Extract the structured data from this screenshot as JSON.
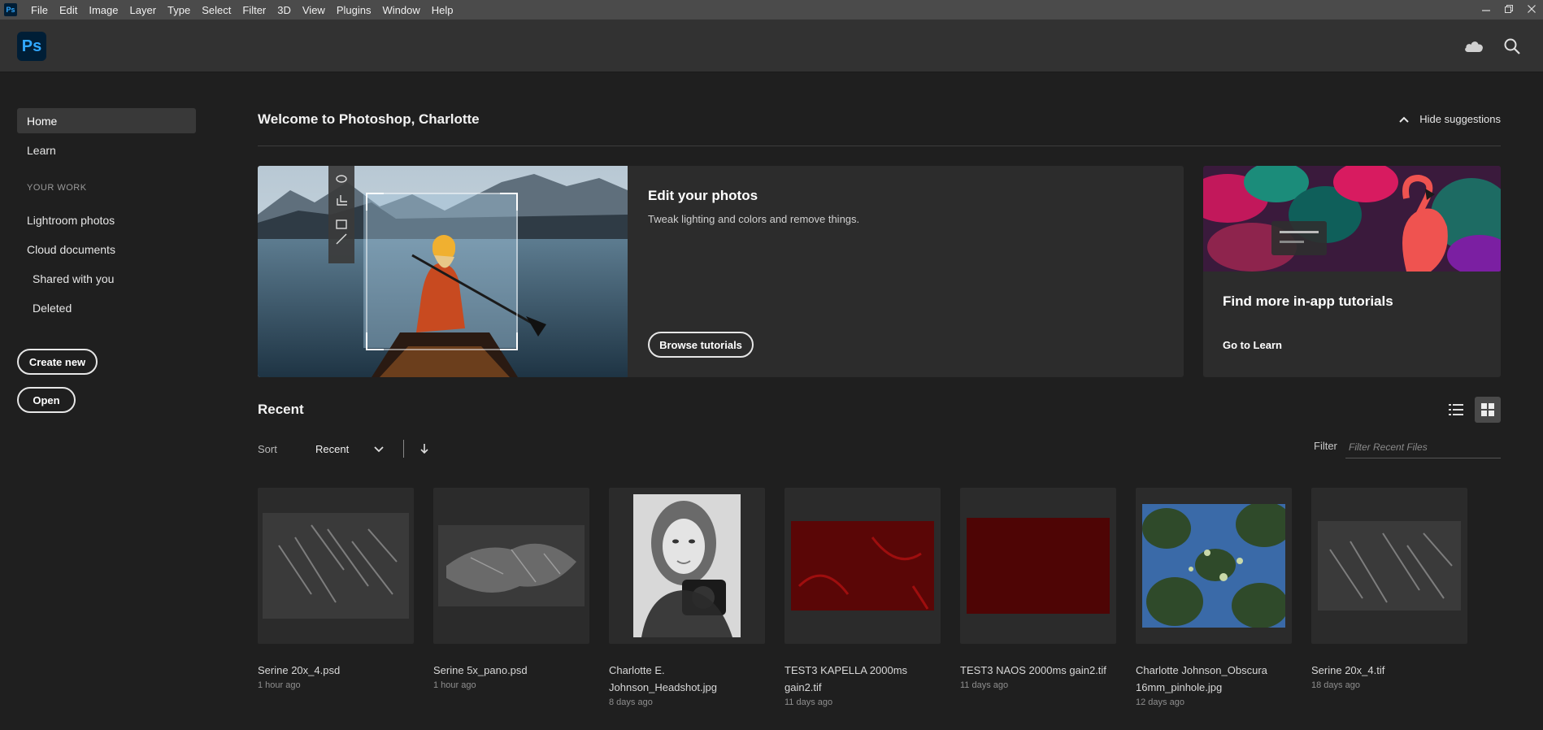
{
  "menubar": {
    "app_icon_text": "Ps",
    "items": [
      "File",
      "Edit",
      "Image",
      "Layer",
      "Type",
      "Select",
      "Filter",
      "3D",
      "View",
      "Plugins",
      "Window",
      "Help"
    ],
    "window_controls": [
      "minimize-icon",
      "restore-icon",
      "close-icon"
    ]
  },
  "header": {
    "logo_text": "Ps",
    "icons": [
      "cloud-icon",
      "search-icon"
    ]
  },
  "sidebar": {
    "home": "Home",
    "learn": "Learn",
    "section_heading": "YOUR WORK",
    "lightroom": "Lightroom photos",
    "cloud_docs": "Cloud documents",
    "shared": "Shared with you",
    "deleted": "Deleted",
    "create_new": "Create new",
    "open": "Open"
  },
  "main": {
    "welcome": "Welcome to Photoshop, Charlotte",
    "hide_suggestions": "Hide suggestions",
    "edit_card": {
      "title": "Edit your photos",
      "description": "Tweak lighting and colors and remove things.",
      "button": "Browse tutorials"
    },
    "tutorial_card": {
      "title": "Find more in-app tutorials",
      "link": "Go to Learn"
    },
    "recent": {
      "title": "Recent",
      "sort_label": "Sort",
      "sort_value": "Recent",
      "filter_label": "Filter",
      "filter_placeholder": "Filter Recent Files",
      "files": [
        {
          "name": "Serine 20x_4.psd",
          "date": "1 hour ago"
        },
        {
          "name": "Serine 5x_pano.psd",
          "date": "1 hour ago"
        },
        {
          "name": "Charlotte E. Johnson_Headshot.jpg",
          "date": "8 days ago"
        },
        {
          "name": "TEST3 KAPELLA 2000ms gain2.tif",
          "date": "11 days ago"
        },
        {
          "name": "TEST3 NAOS 2000ms gain2.tif",
          "date": "11 days ago"
        },
        {
          "name": "Charlotte Johnson_Obscura 16mm_pinhole.jpg",
          "date": "12 days ago"
        },
        {
          "name": "Serine 20x_4.tif",
          "date": "18 days ago"
        }
      ]
    }
  },
  "colors": {
    "background": "#1f1f1f",
    "header": "#323232",
    "card": "#2c2c2c",
    "menubar": "#4b4b4b",
    "ps_blue": "#31a8ff",
    "ps_dark": "#001e36"
  }
}
